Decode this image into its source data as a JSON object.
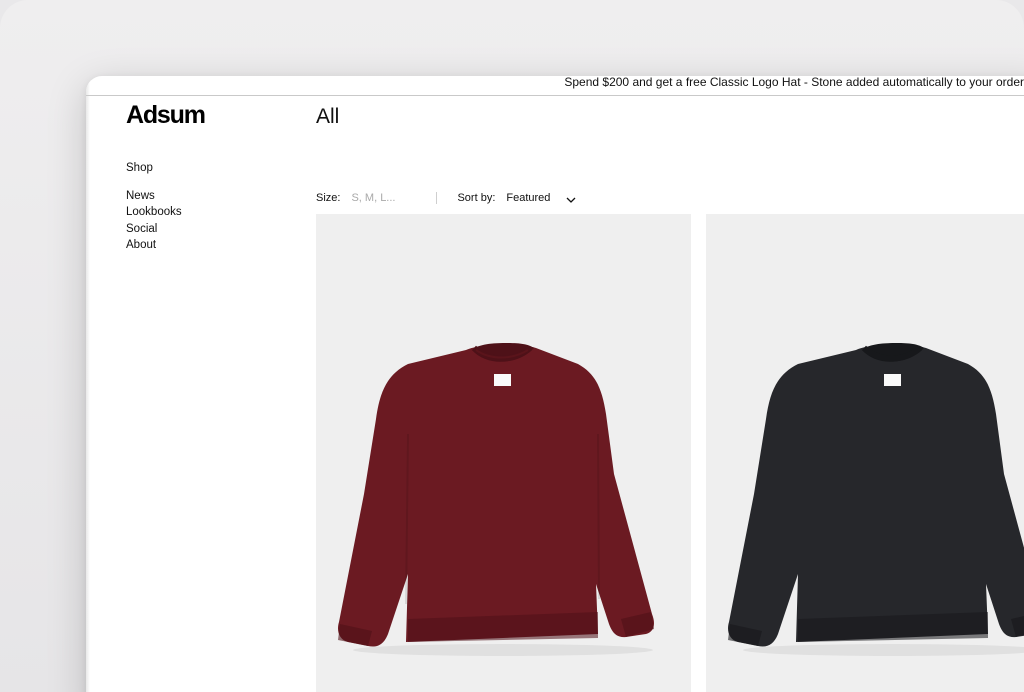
{
  "promo": {
    "text": "Spend $200 and get a free Classic Logo Hat - Stone added automatically to your order"
  },
  "brand": {
    "logo": "Adsum"
  },
  "nav": {
    "shop": "Shop",
    "items": [
      {
        "label": "News"
      },
      {
        "label": "Lookbooks"
      },
      {
        "label": "Social"
      },
      {
        "label": "About"
      }
    ]
  },
  "page": {
    "title": "All"
  },
  "filters": {
    "size_label": "Size:",
    "size_placeholder": "S, M, L...",
    "sort_label": "Sort by:",
    "sort_value": "Featured"
  },
  "products": [
    {
      "color_name": "burgundy",
      "color": "#6b1a22",
      "shadow": "#4e1118"
    },
    {
      "color_name": "black",
      "color": "#26272b",
      "shadow": "#17181b"
    }
  ],
  "colors": {
    "card_bg": "#efefef",
    "text": "#111111",
    "placeholder": "#a9a9a9"
  }
}
